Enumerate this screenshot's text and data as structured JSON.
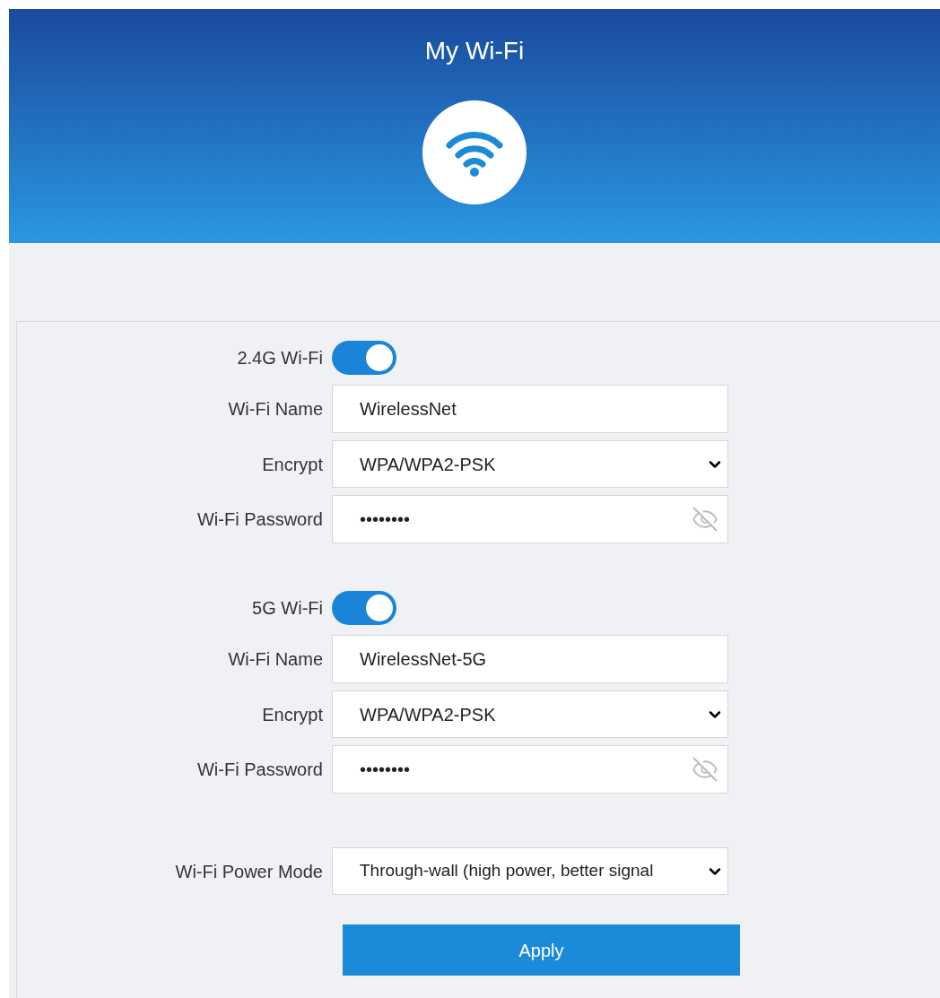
{
  "header": {
    "title": "My Wi-Fi"
  },
  "bands": [
    {
      "label": "2.4G Wi-Fi",
      "on": true,
      "fields": [
        {
          "kind": "text",
          "label": "Wi-Fi Name",
          "value": "WirelessNet"
        },
        {
          "kind": "select",
          "label": "Encrypt",
          "value": "WPA/WPA2-PSK"
        },
        {
          "kind": "password",
          "label": "Wi-Fi Password",
          "value": "••••••••"
        }
      ]
    },
    {
      "label": "5G Wi-Fi",
      "on": true,
      "fields": [
        {
          "kind": "text",
          "label": "Wi-Fi Name",
          "value": "WirelessNet-5G"
        },
        {
          "kind": "select",
          "label": "Encrypt",
          "value": "WPA/WPA2-PSK"
        },
        {
          "kind": "password",
          "label": "Wi-Fi Password",
          "value": "••••••••"
        }
      ]
    }
  ],
  "power_mode": {
    "label": "Wi-Fi Power Mode",
    "value": "Through-wall (high power, better signal"
  },
  "apply_button": "Apply"
}
